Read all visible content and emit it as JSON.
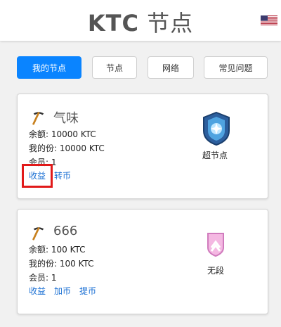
{
  "header": {
    "title_latin": "KTC",
    "title_cn": "节点",
    "flag_icon": "us-flag-icon"
  },
  "tabs": [
    {
      "label": "我的节点",
      "active": true
    },
    {
      "label": "节点",
      "active": false
    },
    {
      "label": "网络",
      "active": false
    },
    {
      "label": "常见问题",
      "active": false
    }
  ],
  "nodes": [
    {
      "icon": "pickaxe-icon",
      "name": "气味",
      "balance": "余额: 10000 KTC",
      "my_share": "我的份: 10000 KTC",
      "members": "会员: 1",
      "actions": [
        "收益",
        "转币"
      ],
      "rank_label": "超节点",
      "rank_icon": "super-node-badge-icon"
    },
    {
      "icon": "pickaxe-icon",
      "name": "666",
      "balance": "余额: 100 KTC",
      "my_share": "我的份: 100 KTC",
      "members": "会员: 1",
      "actions": [
        "收益",
        "加币",
        "提币"
      ],
      "rank_label": "无段",
      "rank_icon": "unranked-badge-icon"
    }
  ],
  "colors": {
    "accent": "#0a84ff",
    "link": "#1a6fd3",
    "highlight": "#e11a1a"
  }
}
